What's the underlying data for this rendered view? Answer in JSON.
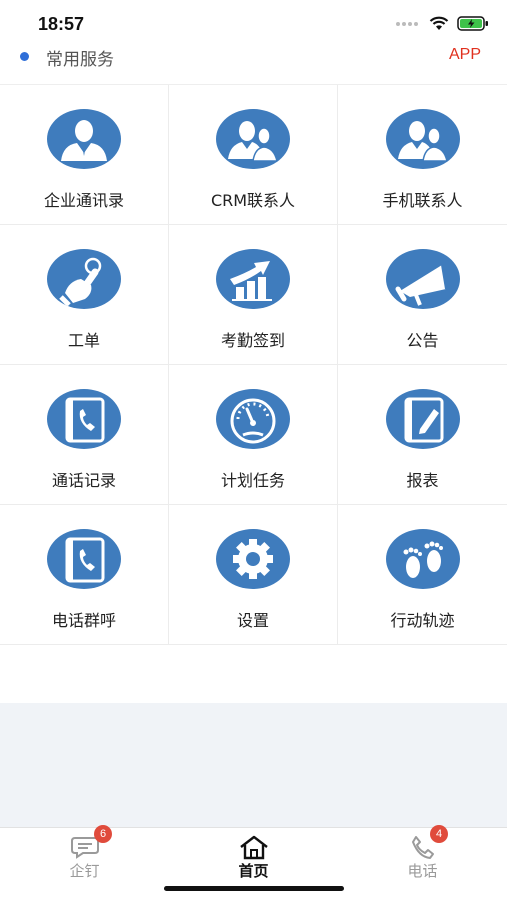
{
  "status_bar": {
    "time": "18:57"
  },
  "section": {
    "title": "常用服务",
    "app_link": "APP"
  },
  "services": [
    {
      "label": "企业通讯录",
      "icon": "person-icon"
    },
    {
      "label": "CRM联系人",
      "icon": "contacts-icon"
    },
    {
      "label": "手机联系人",
      "icon": "contacts-icon"
    },
    {
      "label": "工单",
      "icon": "hand-pointer-icon"
    },
    {
      "label": "考勤签到",
      "icon": "rising-chart-icon"
    },
    {
      "label": "公告",
      "icon": "megaphone-icon"
    },
    {
      "label": "通话记录",
      "icon": "phone-book-icon"
    },
    {
      "label": "计划任务",
      "icon": "gauge-icon"
    },
    {
      "label": "报表",
      "icon": "edit-book-icon"
    },
    {
      "label": "电话群呼",
      "icon": "phone-book-icon"
    },
    {
      "label": "设置",
      "icon": "gear-icon"
    },
    {
      "label": "行动轨迹",
      "icon": "footprints-icon"
    }
  ],
  "tabbar": {
    "tabs": [
      {
        "label": "企钉",
        "badge": "6",
        "icon": "chat-icon",
        "active": false
      },
      {
        "label": "首页",
        "badge": "",
        "icon": "home-icon",
        "active": true
      },
      {
        "label": "电话",
        "badge": "4",
        "icon": "phone-icon",
        "active": false
      }
    ]
  },
  "colors": {
    "icon_blue": "#3f7cbd",
    "accent_red": "#e0301e",
    "badge_red": "#e04b3c",
    "dot_blue": "#2f6fd8"
  }
}
